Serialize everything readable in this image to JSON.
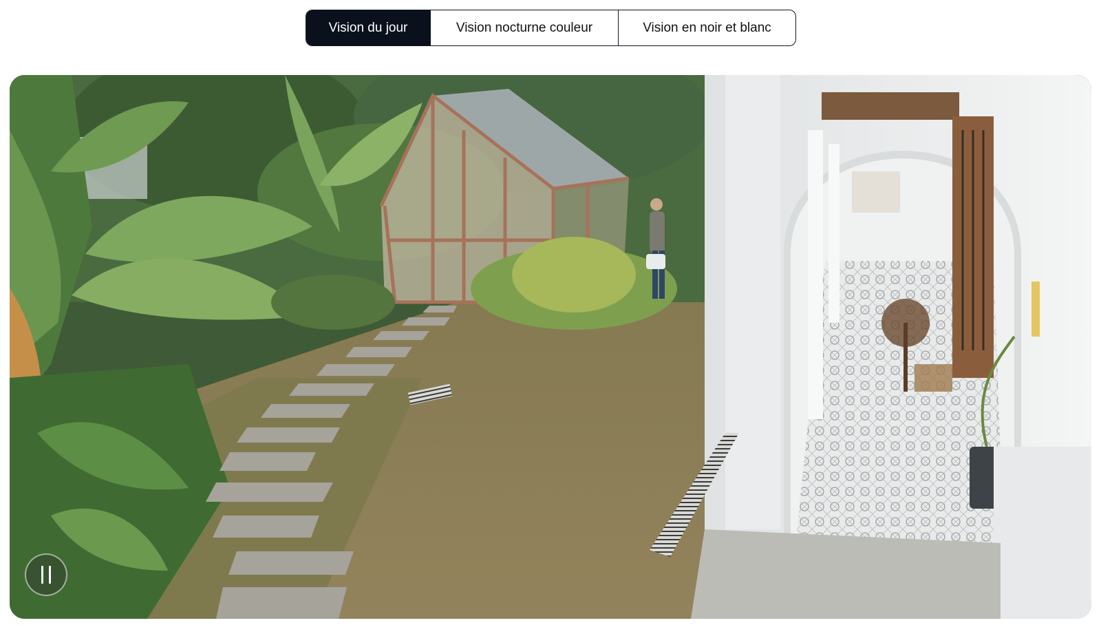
{
  "tabs": [
    {
      "label": "Vision du jour",
      "active": true
    },
    {
      "label": "Vision nocturne couleur",
      "active": false
    },
    {
      "label": "Vision en noir et blanc",
      "active": false
    }
  ],
  "player": {
    "state": "playing",
    "control_icon": "pause-icon"
  },
  "colors": {
    "active_tab_bg": "#0a111d",
    "tab_border": "#0f1621",
    "lawn": "#8e7f57",
    "foliage": "#4f7a3a",
    "wall": "#eef0f0"
  }
}
